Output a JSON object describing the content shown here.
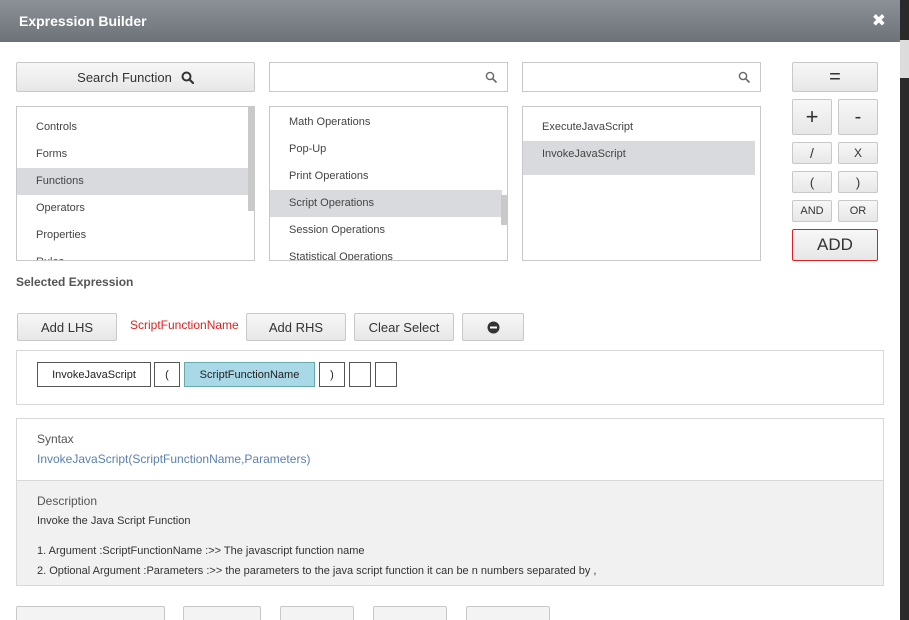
{
  "dialog": {
    "title": "Expression Builder",
    "close_symbol": "✖"
  },
  "search_function": {
    "label": "Search Function"
  },
  "search_inputs": {
    "middle_value": "",
    "right_value": ""
  },
  "categories": {
    "items": [
      "Controls",
      "Forms",
      "Functions",
      "Operators",
      "Properties",
      "Rules"
    ],
    "selected": "Functions"
  },
  "operations": {
    "items": [
      "Math Operations",
      "Pop-Up",
      "Print Operations",
      "Script Operations",
      "Session Operations",
      "Statistical Operations"
    ],
    "selected": "Script Operations"
  },
  "functions": {
    "items": [
      "ExecuteJavaScript",
      "InvokeJavaScript"
    ],
    "selected": "InvokeJavaScript"
  },
  "operators": {
    "equals": "=",
    "plus": "+",
    "minus": "-",
    "divide": "/",
    "multiply": "X",
    "open_paren": "(",
    "close_paren": ")",
    "and": "AND",
    "or": "OR",
    "add": "ADD"
  },
  "selected_expression": {
    "label": "Selected Expression",
    "add_lhs": "Add LHS",
    "lhs_value": "ScriptFunctionName",
    "add_rhs": "Add RHS",
    "clear_select": "Clear Select"
  },
  "expression_tokens": {
    "function": "InvokeJavaScript",
    "open_paren": "(",
    "argument": "ScriptFunctionName",
    "close_paren": ")",
    "empty1": "",
    "empty2": ""
  },
  "syntax": {
    "heading": "Syntax",
    "text": "InvokeJavaScript(ScriptFunctionName,Parameters)"
  },
  "description": {
    "heading": "Description",
    "summary": "Invoke the Java Script Function",
    "arg1": "1. Argument :ScriptFunctionName :>> The javascript function name",
    "arg2": "2. Optional Argument :Parameters :>> the parameters to the java script function it can be n numbers separated by ,"
  },
  "colors": {
    "titlebar": "#7b8087",
    "selected_row": "#d8dadd",
    "active_token": "#a9d8e6",
    "syntax_text": "#5b7fb1",
    "accent_red": "#e02020"
  }
}
